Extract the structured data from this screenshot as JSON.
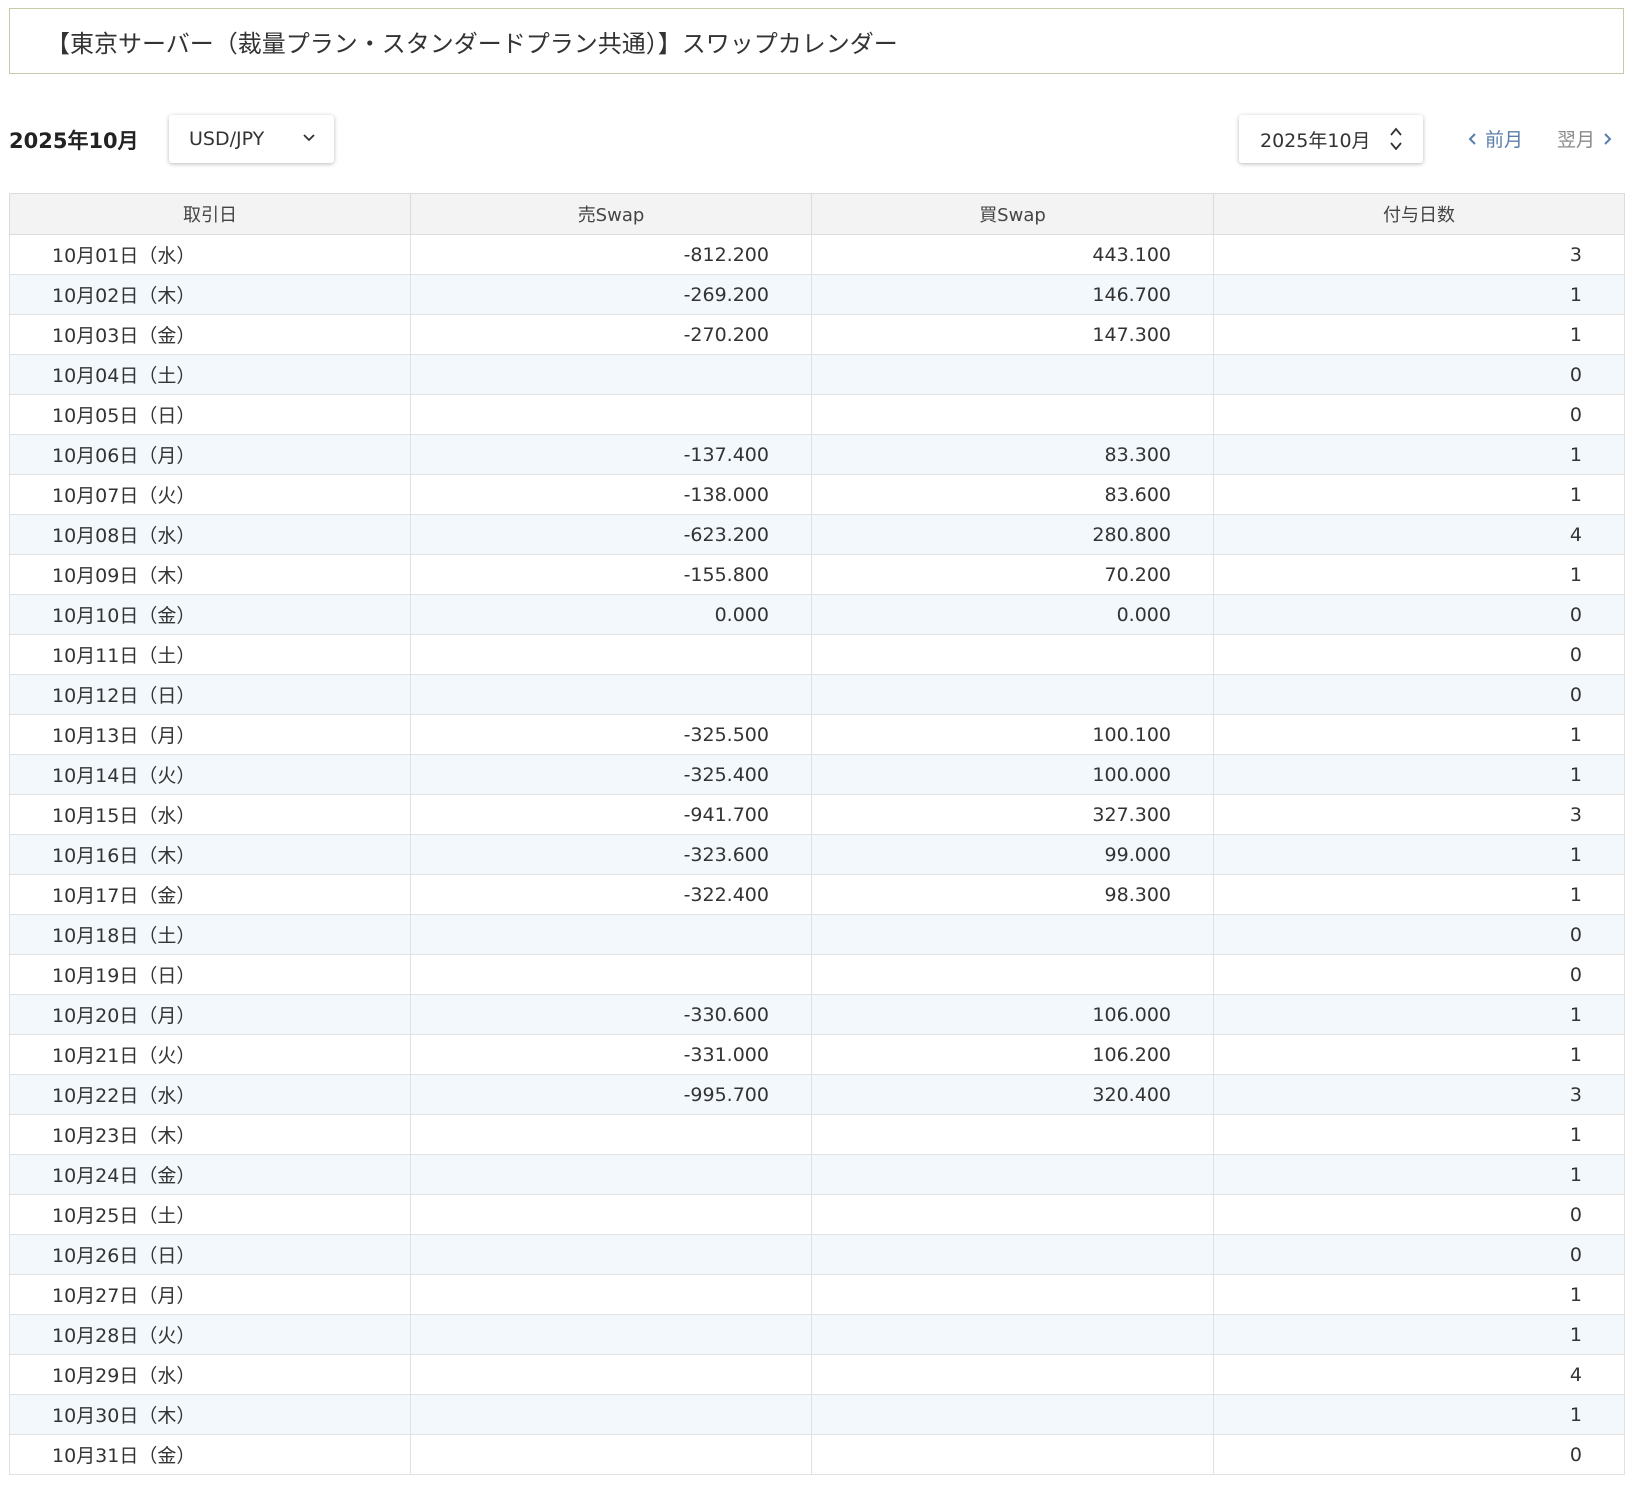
{
  "page": {
    "title": "【東京サーバー（裁量プラン・スタンダードプラン共通）】スワップカレンダー"
  },
  "toolbar": {
    "month_label": "2025年10月",
    "pair_select": "USD/JPY",
    "month_picker": "2025年10月",
    "prev_label": "前月",
    "next_label": "翌月"
  },
  "table": {
    "headers": [
      "取引日",
      "売Swap",
      "買Swap",
      "付与日数"
    ],
    "rows": [
      {
        "date": "10月01日（水）",
        "sell": "-812.200",
        "buy": "443.100",
        "days": "3"
      },
      {
        "date": "10月02日（木）",
        "sell": "-269.200",
        "buy": "146.700",
        "days": "1"
      },
      {
        "date": "10月03日（金）",
        "sell": "-270.200",
        "buy": "147.300",
        "days": "1"
      },
      {
        "date": "10月04日（土）",
        "sell": "",
        "buy": "",
        "days": "0"
      },
      {
        "date": "10月05日（日）",
        "sell": "",
        "buy": "",
        "days": "0"
      },
      {
        "date": "10月06日（月）",
        "sell": "-137.400",
        "buy": "83.300",
        "days": "1"
      },
      {
        "date": "10月07日（火）",
        "sell": "-138.000",
        "buy": "83.600",
        "days": "1"
      },
      {
        "date": "10月08日（水）",
        "sell": "-623.200",
        "buy": "280.800",
        "days": "4"
      },
      {
        "date": "10月09日（木）",
        "sell": "-155.800",
        "buy": "70.200",
        "days": "1"
      },
      {
        "date": "10月10日（金）",
        "sell": "0.000",
        "buy": "0.000",
        "days": "0"
      },
      {
        "date": "10月11日（土）",
        "sell": "",
        "buy": "",
        "days": "0"
      },
      {
        "date": "10月12日（日）",
        "sell": "",
        "buy": "",
        "days": "0"
      },
      {
        "date": "10月13日（月）",
        "sell": "-325.500",
        "buy": "100.100",
        "days": "1"
      },
      {
        "date": "10月14日（火）",
        "sell": "-325.400",
        "buy": "100.000",
        "days": "1"
      },
      {
        "date": "10月15日（水）",
        "sell": "-941.700",
        "buy": "327.300",
        "days": "3"
      },
      {
        "date": "10月16日（木）",
        "sell": "-323.600",
        "buy": "99.000",
        "days": "1"
      },
      {
        "date": "10月17日（金）",
        "sell": "-322.400",
        "buy": "98.300",
        "days": "1"
      },
      {
        "date": "10月18日（土）",
        "sell": "",
        "buy": "",
        "days": "0"
      },
      {
        "date": "10月19日（日）",
        "sell": "",
        "buy": "",
        "days": "0"
      },
      {
        "date": "10月20日（月）",
        "sell": "-330.600",
        "buy": "106.000",
        "days": "1"
      },
      {
        "date": "10月21日（火）",
        "sell": "-331.000",
        "buy": "106.200",
        "days": "1"
      },
      {
        "date": "10月22日（水）",
        "sell": "-995.700",
        "buy": "320.400",
        "days": "3"
      },
      {
        "date": "10月23日（木）",
        "sell": "",
        "buy": "",
        "days": "1"
      },
      {
        "date": "10月24日（金）",
        "sell": "",
        "buy": "",
        "days": "1"
      },
      {
        "date": "10月25日（土）",
        "sell": "",
        "buy": "",
        "days": "0"
      },
      {
        "date": "10月26日（日）",
        "sell": "",
        "buy": "",
        "days": "0"
      },
      {
        "date": "10月27日（月）",
        "sell": "",
        "buy": "",
        "days": "1"
      },
      {
        "date": "10月28日（火）",
        "sell": "",
        "buy": "",
        "days": "1"
      },
      {
        "date": "10月29日（水）",
        "sell": "",
        "buy": "",
        "days": "4"
      },
      {
        "date": "10月30日（木）",
        "sell": "",
        "buy": "",
        "days": "1"
      },
      {
        "date": "10月31日（金）",
        "sell": "",
        "buy": "",
        "days": "0"
      }
    ]
  },
  "icons": {
    "pair_select": "chevron-down-icon",
    "month_picker": "up-down-arrows-icon",
    "prev": "chevron-left-icon",
    "next": "chevron-right-icon"
  },
  "colors": {
    "title_border": "#c9c9a8",
    "prev_link": "#5a7fa8",
    "next_link": "#8a8a8a",
    "header_bg": "#f3f3f3",
    "alt_row_bg": "#f3f8fd"
  }
}
